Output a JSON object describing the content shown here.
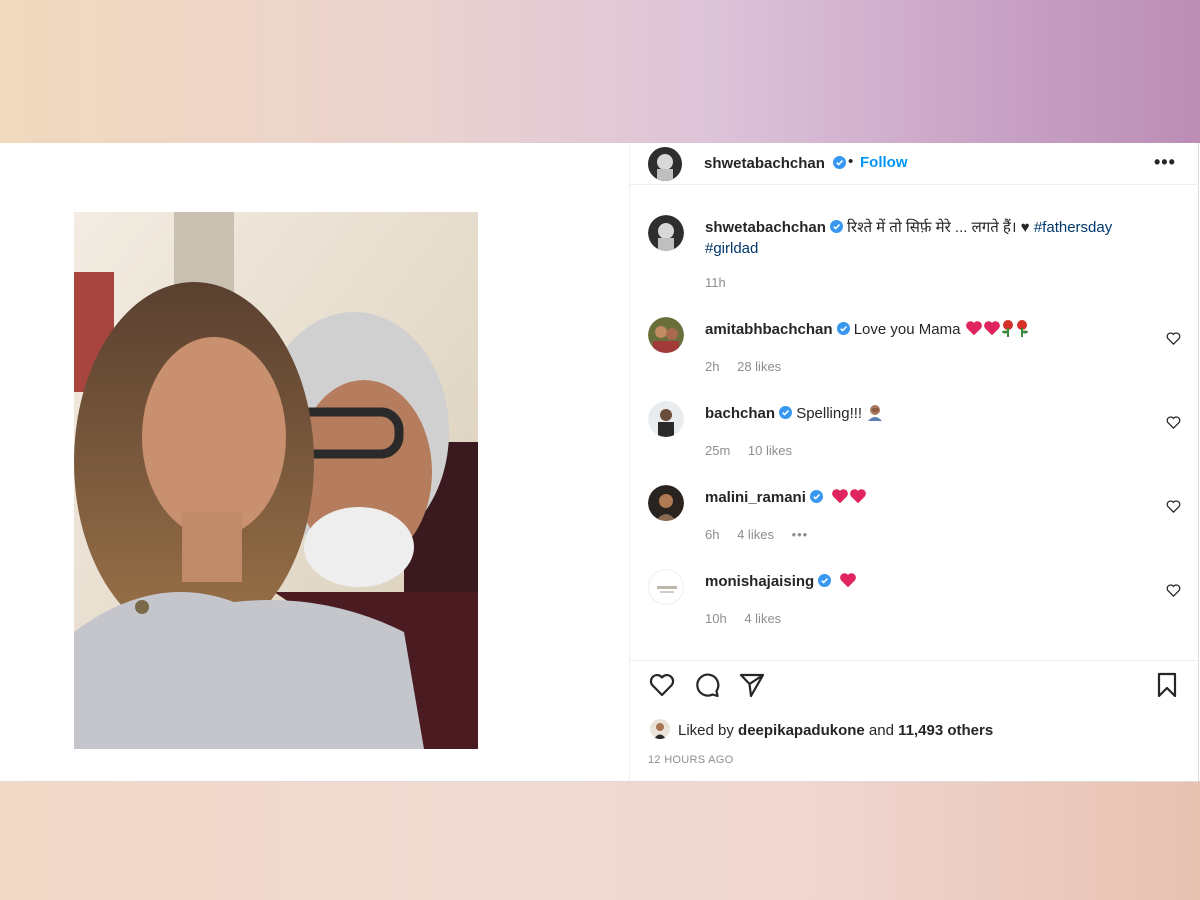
{
  "post": {
    "username": "shwetabachchan",
    "follow_label": "Follow",
    "separator": "•",
    "more_label": "•••"
  },
  "caption": {
    "username": "shwetabachchan",
    "text": "रिश्ते में तो सिर्फ़ मेरे ... लगते हैं। ♥",
    "hashtag1": "#fathersday",
    "hashtag2": "#girldad",
    "time": "11h"
  },
  "comments": [
    {
      "username": "amitabhbachchan",
      "text": "Love you Mama",
      "time": "2h",
      "likes": "28 likes"
    },
    {
      "username": "bachchan",
      "text": "Spelling!!!",
      "time": "25m",
      "likes": "10 likes"
    },
    {
      "username": "malini_ramani",
      "text": "",
      "time": "6h",
      "likes": "4 likes",
      "more": "•••"
    },
    {
      "username": "monishajaising",
      "text": "",
      "time": "10h",
      "likes": "4 likes"
    }
  ],
  "likes": {
    "prefix": "Liked by",
    "user": "deepikapadukone",
    "and": "and",
    "others": "11,493 others"
  },
  "timestamp": "12 HOURS AGO",
  "icons": {
    "verified": "verified-badge-icon",
    "like": "heart-icon",
    "comment": "comment-bubble-icon",
    "share": "paper-plane-icon",
    "save": "bookmark-icon",
    "emoji_heart": "red-heart-emoji",
    "emoji_rose": "rose-emoji",
    "emoji_facepalm": "facepalm-emoji"
  },
  "colors": {
    "link": "#0095f6",
    "hashtag": "#00376b",
    "verified": "#3897f0",
    "muted": "#8e8e8e",
    "heart": "#e0245e"
  }
}
